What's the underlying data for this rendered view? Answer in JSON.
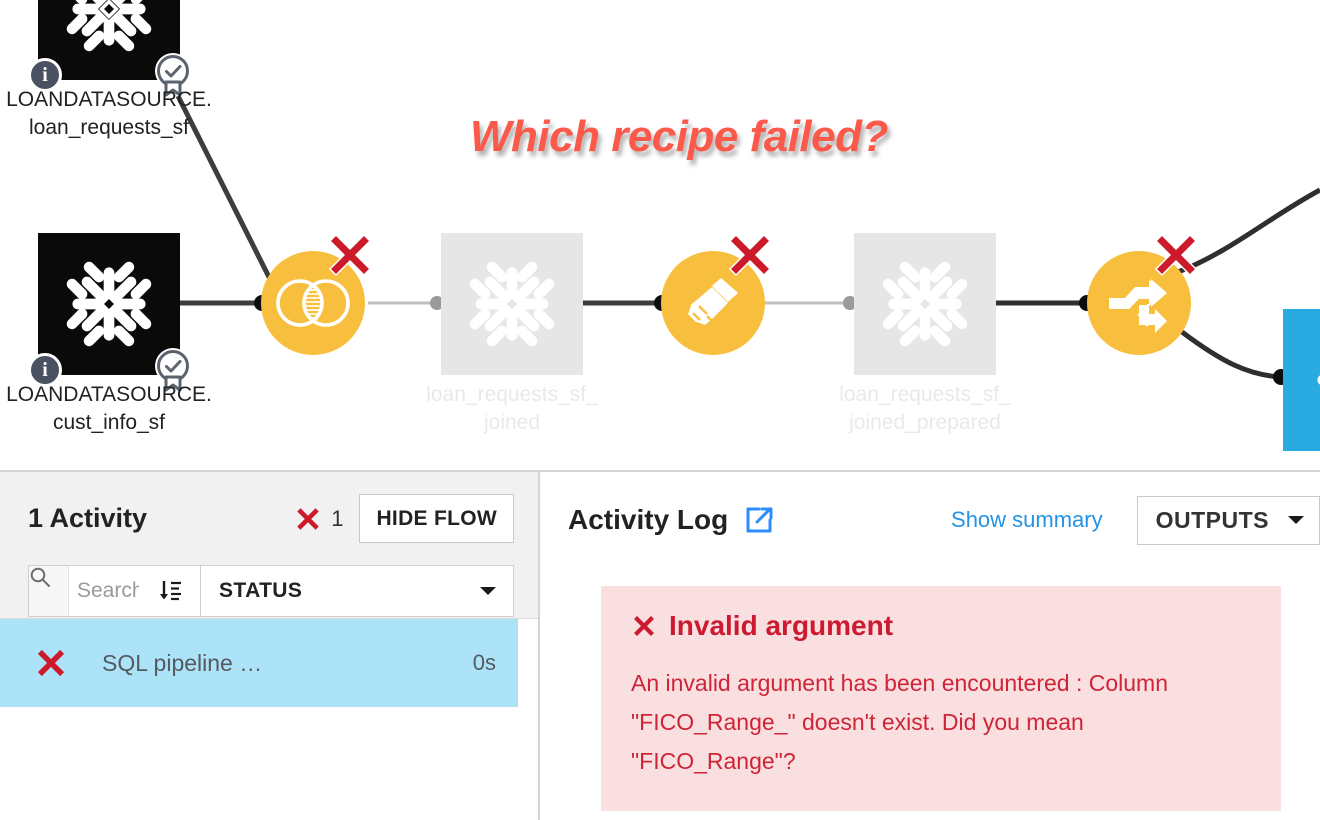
{
  "annotation": {
    "text": "Which recipe failed?",
    "color": "#fb5a4b"
  },
  "flow": {
    "datasets": [
      {
        "id": "loan_requests_sf",
        "connection": "LOANDATASOURCE.",
        "name": "loan_requests_sf",
        "label": "LOANDATASOURCE.\nloan_requests_sf",
        "type": "snowflake",
        "state": "active",
        "info_icon": "info-icon",
        "cert_icon": "certified-badge-icon"
      },
      {
        "id": "cust_info_sf",
        "connection": "LOANDATASOURCE.",
        "name": "cust_info_sf",
        "label": "LOANDATASOURCE.\ncust_info_sf",
        "type": "snowflake",
        "state": "active",
        "info_icon": "info-icon",
        "cert_icon": "certified-badge-icon"
      },
      {
        "id": "loan_requests_sf_joined",
        "name": "loan_requests_sf_joined",
        "label": "loan_requests_sf_\njoined",
        "type": "snowflake",
        "state": "dimmed"
      },
      {
        "id": "loan_requests_sf_joined_prepared",
        "name": "loan_requests_sf_joined_prepared",
        "label": "loan_requests_sf_\njoined_prepared",
        "type": "snowflake",
        "state": "dimmed"
      },
      {
        "id": "output_dataset",
        "name": "",
        "label": "",
        "type": "dataiku",
        "state": "active"
      }
    ],
    "recipes": [
      {
        "id": "join",
        "icon": "join-recipe-icon",
        "status": "failed",
        "color": "#f8be3d"
      },
      {
        "id": "prepare",
        "icon": "prepare-recipe-icon",
        "status": "failed",
        "color": "#f8be3d"
      },
      {
        "id": "split",
        "icon": "split-recipe-icon",
        "status": "failed",
        "color": "#f8be3d"
      }
    ],
    "error_marker_color": "#cc1a2b"
  },
  "activities": {
    "title": "1 Activity",
    "failed_count": "1",
    "hide_flow_label": "HIDE FLOW",
    "search_placeholder": "Search a",
    "search_value": "",
    "sort_icon": "sort-descending-icon",
    "status_filter_label": "STATUS",
    "rows": [
      {
        "status": "failed",
        "name": "SQL pipeline …",
        "duration": "0s",
        "selected": true
      }
    ]
  },
  "activity_log": {
    "title": "Activity Log",
    "external_link_icon": "external-link-icon",
    "show_summary_label": "Show summary",
    "outputs_label": "OUTPUTS",
    "error": {
      "title": "Invalid argument",
      "message": "An invalid argument has been encountered : Column \"FICO_Range_\" doesn't exist. Did you mean \"FICO_Range\"?",
      "bg_color": "#fadfe1",
      "text_color": "#cf2436"
    }
  }
}
